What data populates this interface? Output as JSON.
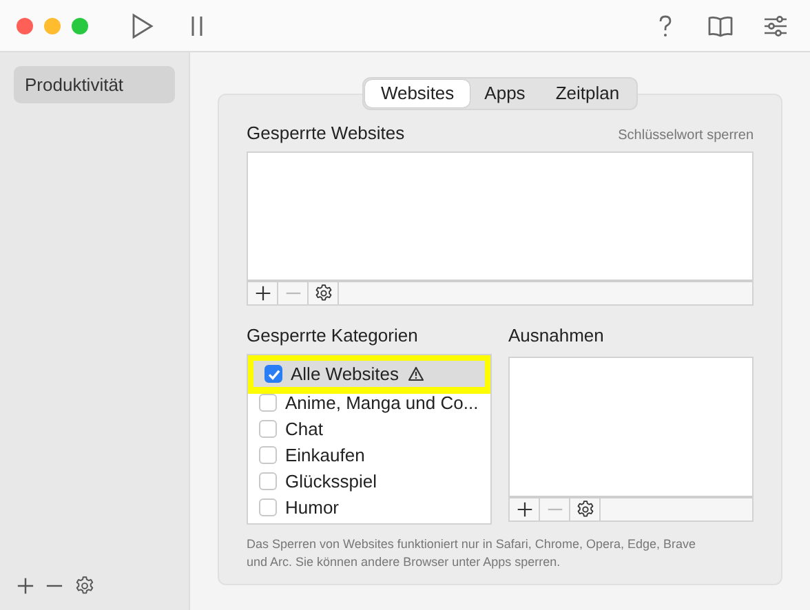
{
  "toolbar": {
    "buttons": [
      {
        "kind": "play"
      },
      {
        "kind": "pause"
      },
      {
        "kind": "help"
      },
      {
        "kind": "book"
      },
      {
        "kind": "sliders"
      }
    ]
  },
  "sidebar": {
    "items": [
      {
        "label": "Produktivität",
        "selected": true
      }
    ],
    "footer_buttons": [
      {
        "kind": "add"
      },
      {
        "kind": "remove"
      },
      {
        "kind": "settings"
      }
    ]
  },
  "tabs": [
    {
      "label": "Websites",
      "selected": true
    },
    {
      "label": "Apps",
      "selected": false
    },
    {
      "label": "Zeitplan",
      "selected": false
    }
  ],
  "blocked_websites": {
    "title": "Gesperrte Websites",
    "link": "Schlüsselwort sperren",
    "buttons": [
      {
        "kind": "add",
        "disabled": false
      },
      {
        "kind": "remove",
        "disabled": true
      },
      {
        "kind": "settings",
        "disabled": false
      }
    ]
  },
  "blocked_categories": {
    "title": "Gesperrte Kategorien",
    "items": [
      {
        "label": "Alle Websites",
        "checked": true,
        "selected": true,
        "warning": true,
        "highlighted": true
      },
      {
        "label": "Anime, Manga und Co...",
        "checked": false,
        "selected": false,
        "warning": false,
        "highlighted": false
      },
      {
        "label": "Chat",
        "checked": false,
        "selected": false,
        "warning": false,
        "highlighted": false
      },
      {
        "label": "Einkaufen",
        "checked": false,
        "selected": false,
        "warning": false,
        "highlighted": false
      },
      {
        "label": "Glücksspiel",
        "checked": false,
        "selected": false,
        "warning": false,
        "highlighted": false
      },
      {
        "label": "Humor",
        "checked": false,
        "selected": false,
        "warning": false,
        "highlighted": false
      }
    ]
  },
  "exceptions": {
    "title": "Ausnahmen",
    "buttons": [
      {
        "kind": "add",
        "disabled": false
      },
      {
        "kind": "remove",
        "disabled": true
      },
      {
        "kind": "settings",
        "disabled": false
      }
    ]
  },
  "note": "Das Sperren von Websites funktioniert nur in Safari, Chrome, Opera, Edge, Brave und Arc. Sie können andere Browser unter Apps sperren."
}
